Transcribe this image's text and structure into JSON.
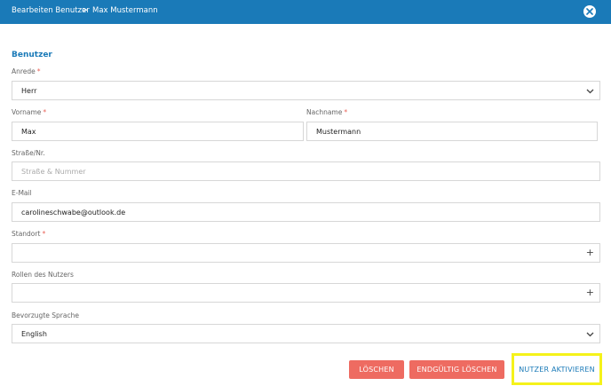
{
  "header": {
    "breadcrumb_parent": "Bearbeiten Benutzer",
    "breadcrumb_separator": ">",
    "breadcrumb_current": "Max Mustermann"
  },
  "section": {
    "title": "Benutzer"
  },
  "form": {
    "anrede": {
      "label": "Anrede",
      "value": "Herr"
    },
    "vorname": {
      "label": "Vorname",
      "value": "Max"
    },
    "nachname": {
      "label": "Nachname",
      "value": "Mustermann"
    },
    "strasse": {
      "label": "Straße/Nr.",
      "placeholder": "Straße & Nummer"
    },
    "email": {
      "label": "E-Mail",
      "value": "carolineschwabe@outlook.de"
    },
    "standort": {
      "label": "Standort",
      "add_symbol": "+"
    },
    "rollen": {
      "label": "Rollen des Nutzers",
      "add_symbol": "+"
    },
    "sprache": {
      "label": "Bevorzugte Sprache",
      "value": "English"
    },
    "required_marker": "*"
  },
  "actions": {
    "delete_label": "LÖSCHEN",
    "delete_final_label": "ENDGÜLTIG LÖSCHEN",
    "activate_label": "NUTZER AKTIVIEREN"
  },
  "colors": {
    "header": "#1a7ab8",
    "accent": "#1a7ab8",
    "danger": "#ee6b61",
    "highlight": "#f5f21a",
    "required": "#e8635a"
  },
  "icons": {
    "close": "close-icon",
    "dropdown": "chevron-down-icon",
    "add": "plus-icon"
  }
}
